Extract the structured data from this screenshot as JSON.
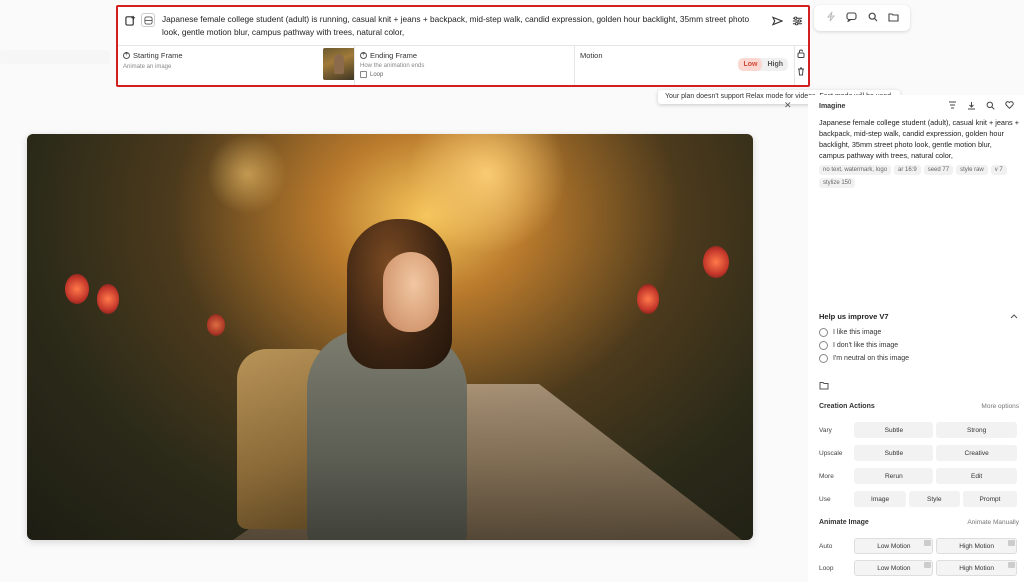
{
  "prompt_panel": {
    "prompt_text": "Japanese female college student (adult) is running, casual knit + jeans + backpack, mid-step walk, candid expression, golden hour backlight, 35mm street photo look, gentle motion blur, campus pathway with trees, natural color,",
    "starting_frame": {
      "label": "Starting Frame",
      "sub": "Animate an image"
    },
    "ending_frame": {
      "label": "Ending Frame",
      "sub": "How the animation ends",
      "loop_label": "Loop"
    },
    "motion": {
      "label": "Motion",
      "options": [
        "Low",
        "High"
      ],
      "selected": "Low"
    }
  },
  "tooltip": "Your plan doesn't support Relax mode for videos. Fast mode will be used.",
  "top_tools": {
    "icons": [
      "bolt-icon",
      "chat-icon",
      "search-icon",
      "folder-icon"
    ]
  },
  "sidebar": {
    "title": "Imagine",
    "prompt": "Japanese female college student (adult), casual knit + jeans + backpack, mid-step walk, candid expression, golden hour backlight, 35mm street photo look, gentle motion blur, campus pathway with trees, natural color,",
    "tags": [
      "no text, watermark, logo",
      "ar 16:9",
      "seed 77",
      "style raw",
      "v 7",
      "stylize 150"
    ],
    "help": {
      "title": "Help us improve V7",
      "options": [
        "I like this image",
        "I don't like this image",
        "I'm neutral on this image"
      ]
    },
    "creation_actions": {
      "title": "Creation Actions",
      "more_link": "More options",
      "rows": [
        {
          "label": "Vary",
          "buttons": [
            "Subtle",
            "Strong"
          ]
        },
        {
          "label": "Upscale",
          "buttons": [
            "Subtle",
            "Creative"
          ]
        },
        {
          "label": "More",
          "buttons": [
            "Rerun",
            "Edit"
          ]
        },
        {
          "label": "Use",
          "buttons": [
            "Image",
            "Style",
            "Prompt"
          ]
        }
      ]
    },
    "animate_image": {
      "title": "Animate Image",
      "link": "Animate Manually",
      "rows": [
        {
          "label": "Auto",
          "buttons": [
            "Low Motion",
            "High Motion"
          ]
        },
        {
          "label": "Loop",
          "buttons": [
            "Low Motion",
            "High Motion"
          ]
        }
      ]
    }
  }
}
